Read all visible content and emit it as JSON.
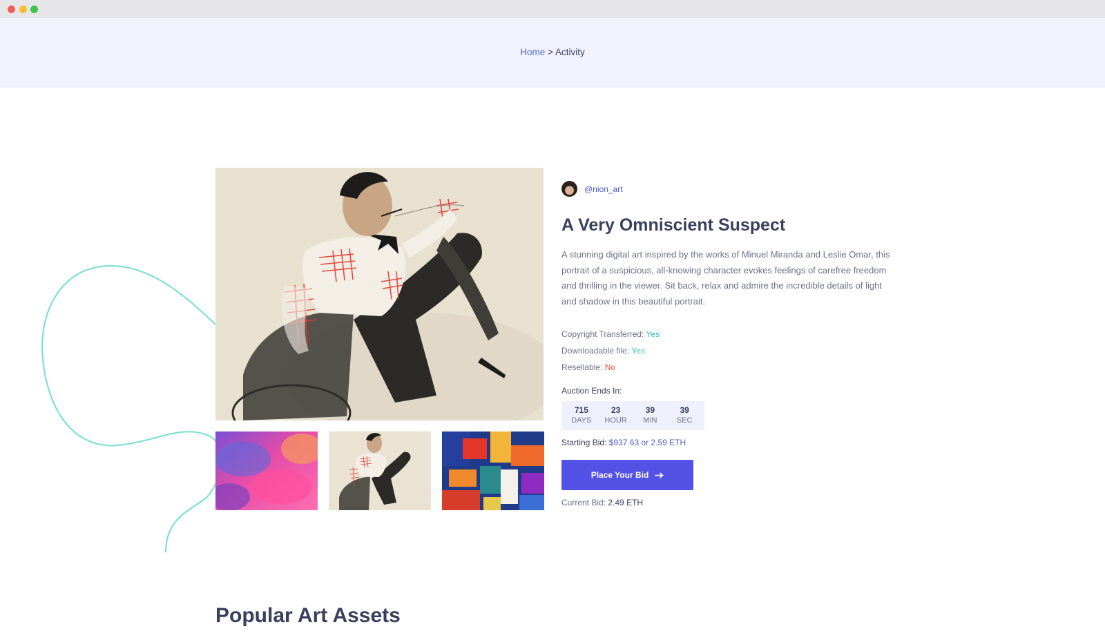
{
  "breadcrumb": {
    "home": "Home",
    "separator": ">",
    "current": "Activity"
  },
  "artwork": {
    "author_handle": "@nion_art",
    "title": "A Very Omniscient Suspect",
    "description": "A stunning digital art inspired by the works of Minuel Miranda and Leslie Omar, this portrait of a suspicious, all-knowing character evokes feelings of carefree freedom and thrilling in the viewer. Sit back, relax and admire the incredible details of light and shadow in this beautiful portrait."
  },
  "meta": {
    "copyright_label": "Copyright Transferred:",
    "copyright_value": "Yes",
    "downloadable_label": "Downloadable file:",
    "downloadable_value": "Yes",
    "resellable_label": "Resellable:",
    "resellable_value": "No"
  },
  "auction": {
    "label": "Auction Ends In:",
    "countdown": [
      {
        "value": "715",
        "unit": "DAYS"
      },
      {
        "value": "23",
        "unit": "HOUR"
      },
      {
        "value": "39",
        "unit": "MIN"
      },
      {
        "value": "39",
        "unit": "SEC"
      }
    ],
    "starting_bid_label": "Starting Bid:",
    "starting_bid_value": "$937.63 or 2.59 ETH",
    "bid_button_label": "Place Your Bid",
    "current_bid_label": "Current Bid:",
    "current_bid_value": "2.49 ETH"
  },
  "popular": {
    "title": "Popular Art Assets"
  },
  "colors": {
    "accent": "#5451e6",
    "link": "#4b5bc4",
    "yes": "#36c3b3",
    "no": "#ea4f3a",
    "hero_bg": "#f1f2fd",
    "swirl": "#7fe0d2"
  },
  "icons": {
    "bid_button": "arrow-right-icon"
  }
}
